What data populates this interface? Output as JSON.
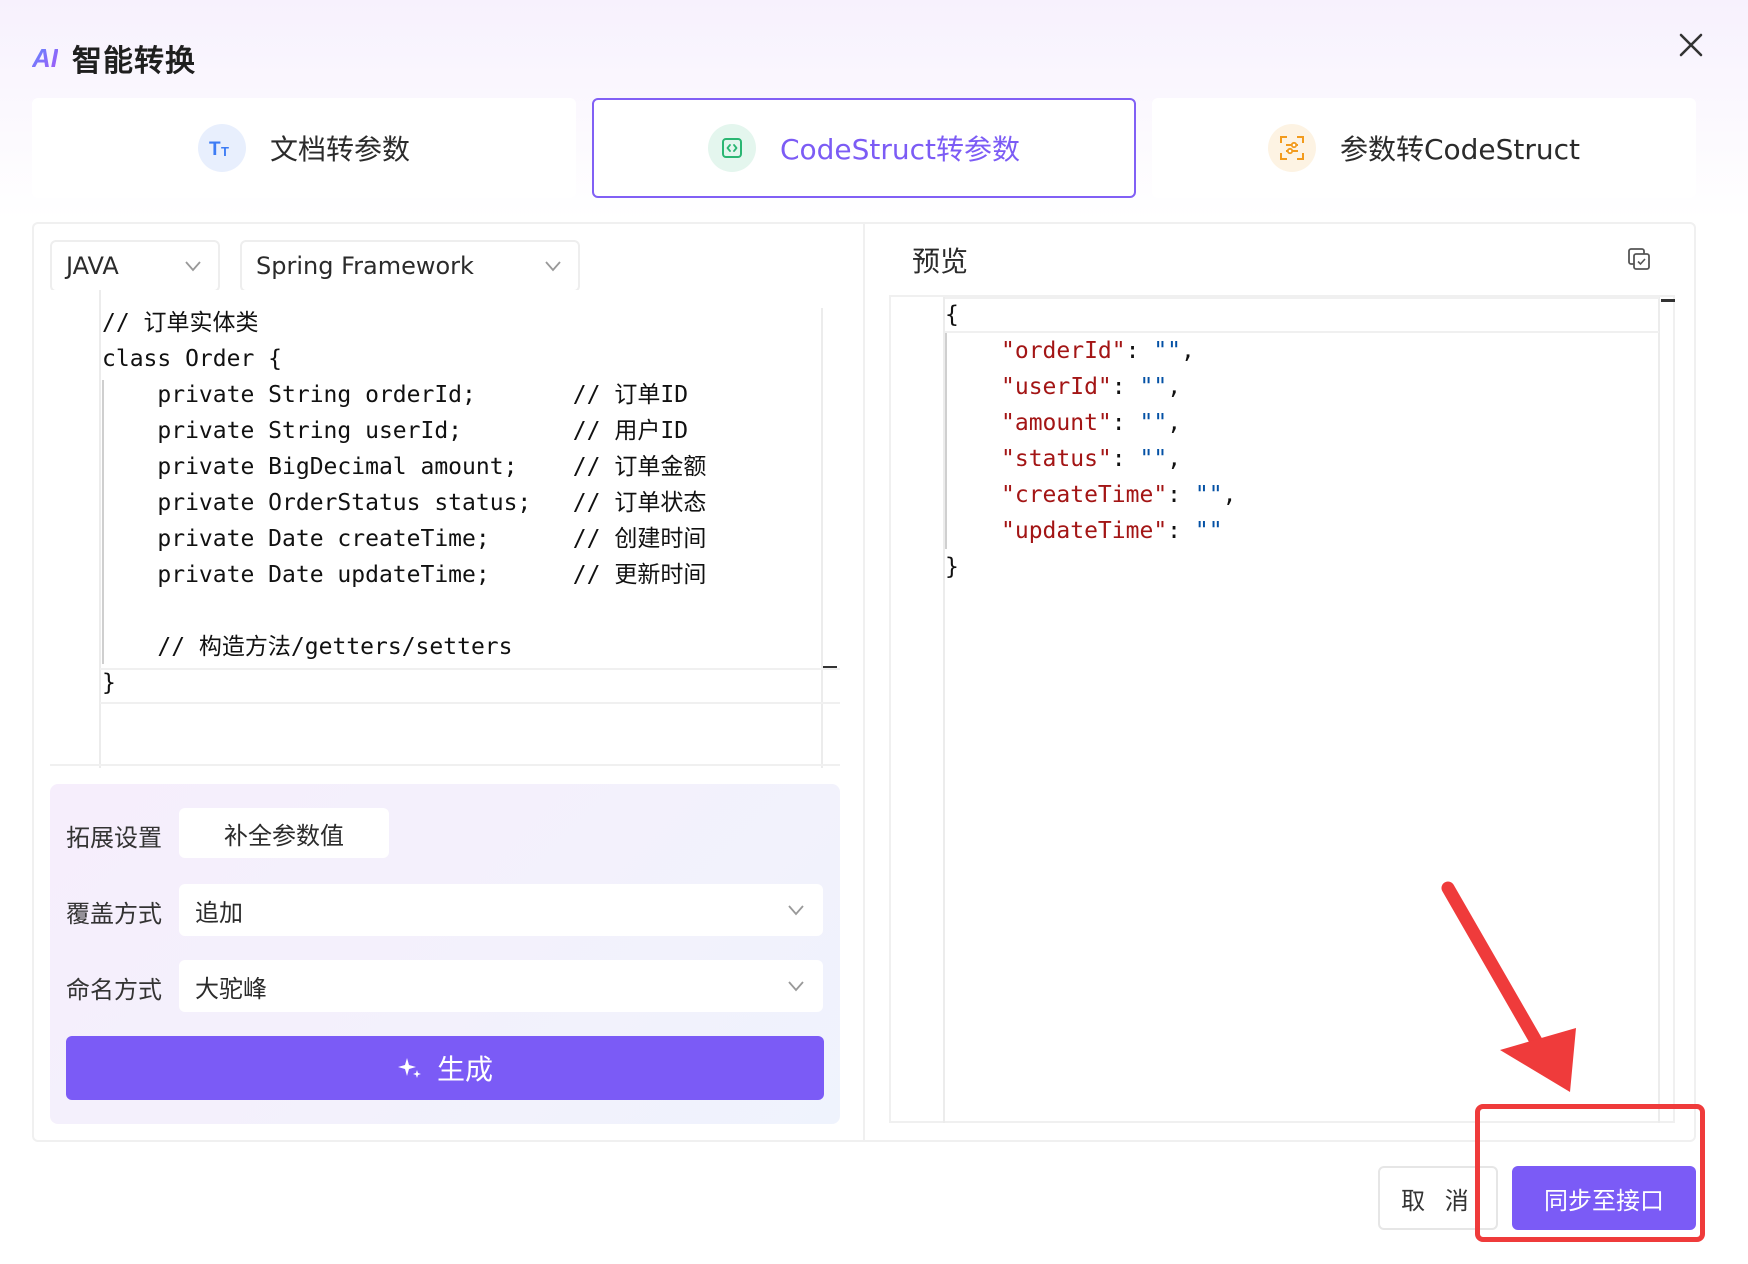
{
  "header": {
    "logo_text": "AI",
    "title": "智能转换"
  },
  "tabs": [
    {
      "label": "文档转参数",
      "icon": "text-format-icon"
    },
    {
      "label": "CodeStruct转参数",
      "icon": "code-icon",
      "active": true
    },
    {
      "label": "参数转CodeStruct",
      "icon": "scan-settings-icon"
    }
  ],
  "editor": {
    "language": "JAVA",
    "framework": "Spring Framework",
    "code_lines": [
      "// 订单实体类",
      "class Order {",
      "    private String orderId;       // 订单ID",
      "    private String userId;        // 用户ID",
      "    private BigDecimal amount;    // 订单金额",
      "    private OrderStatus status;   // 订单状态",
      "    private Date createTime;      // 创建时间",
      "    private Date updateTime;      // 更新时间",
      "",
      "    // 构造方法/getters/setters",
      "}"
    ]
  },
  "preview": {
    "title": "预览",
    "open_brace": "{",
    "close_brace": "}",
    "fields": [
      {
        "key": "\"orderId\"",
        "value": "\"\"",
        "trail": ","
      },
      {
        "key": "\"userId\"",
        "value": "\"\"",
        "trail": ","
      },
      {
        "key": "\"amount\"",
        "value": "\"\"",
        "trail": ","
      },
      {
        "key": "\"status\"",
        "value": "\"\"",
        "trail": ","
      },
      {
        "key": "\"createTime\"",
        "value": "\"\"",
        "trail": ","
      },
      {
        "key": "\"updateTime\"",
        "value": "\"\"",
        "trail": ""
      }
    ]
  },
  "settings": {
    "extend_label": "拓展设置",
    "extend_chip": "补全参数值",
    "overwrite_label": "覆盖方式",
    "overwrite_value": "追加",
    "naming_label": "命名方式",
    "naming_value": "大驼峰",
    "generate_label": "生成"
  },
  "footer": {
    "cancel_label": "取 消",
    "sync_label": "同步至接口"
  },
  "colors": {
    "accent": "#7b5bf6",
    "annotation": "#ef3b3b",
    "json_key": "#a31515",
    "json_string": "#0451a5"
  }
}
